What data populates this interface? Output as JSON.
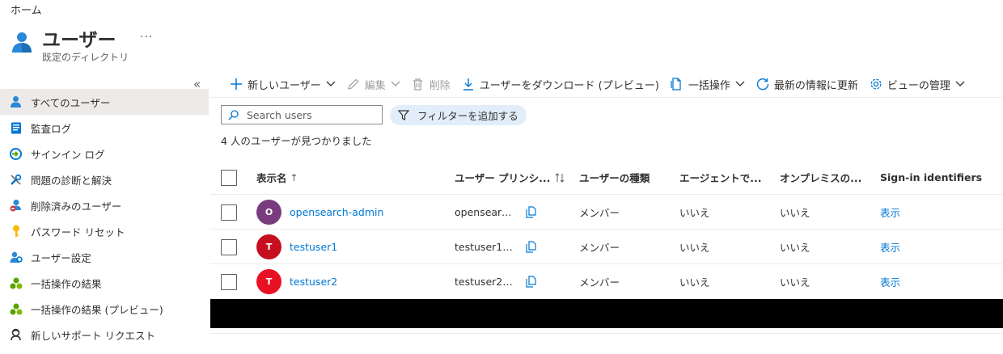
{
  "breadcrumb": "ホーム",
  "header": {
    "title": "ユーザー",
    "subtitle": "既定のディレクトリ",
    "more": "..."
  },
  "sidebar": {
    "collapse": "«",
    "items": [
      {
        "label": "すべてのユーザー",
        "icon": "user-icon",
        "active": true
      },
      {
        "label": "監査ログ",
        "icon": "audit-log-icon"
      },
      {
        "label": "サインイン ログ",
        "icon": "sign-in-log-icon"
      },
      {
        "label": "問題の診断と解決",
        "icon": "wrench-icon"
      },
      {
        "label": "削除済みのユーザー",
        "icon": "deleted-user-icon"
      },
      {
        "label": "パスワード リセット",
        "icon": "key-icon"
      },
      {
        "label": "ユーザー設定",
        "icon": "user-settings-icon"
      },
      {
        "label": "一括操作の結果",
        "icon": "bulk-results-icon"
      },
      {
        "label": "一括操作の結果 (プレビュー)",
        "icon": "bulk-results-icon"
      },
      {
        "label": "新しいサポート リクエスト",
        "icon": "support-icon"
      }
    ]
  },
  "toolbar": {
    "new_user": "新しいユーザー",
    "edit": "編集",
    "delete": "削除",
    "download": "ユーザーをダウンロード (プレビュー)",
    "bulk": "一括操作",
    "refresh": "最新の情報に更新",
    "manage_view": "ビューの管理"
  },
  "search": {
    "placeholder": "Search users"
  },
  "filter": {
    "label": "フィルターを追加する"
  },
  "result_count": "4 人のユーザーが見つかりました",
  "table": {
    "columns": {
      "name": "表示名",
      "upn": "ユーザー プリンシ...",
      "type": "ユーザーの種類",
      "agent": "エージェントで...",
      "onprem": "オンプレミスの...",
      "signin": "Sign-in identifiers"
    },
    "sort_indicator": "↑",
    "rows": [
      {
        "initial": "O",
        "avatar_color": "#7a3b7e",
        "name": "opensearch-admin",
        "upn": "opensearc...",
        "type": "メンバー",
        "agent": "いいえ",
        "onprem": "いいえ",
        "signin": "表示"
      },
      {
        "initial": "T",
        "avatar_color": "#c50f1f",
        "name": "testuser1",
        "upn": "testuser1@...",
        "type": "メンバー",
        "agent": "いいえ",
        "onprem": "いいえ",
        "signin": "表示"
      },
      {
        "initial": "T",
        "avatar_color": "#e81123",
        "name": "testuser2",
        "upn": "testuser2@...",
        "type": "メンバー",
        "agent": "いいえ",
        "onprem": "いいえ",
        "signin": "表示"
      }
    ]
  },
  "colors": {
    "accent": "#0078d4",
    "active_bg": "#edebe9",
    "filter_bg": "#e1eef9"
  }
}
